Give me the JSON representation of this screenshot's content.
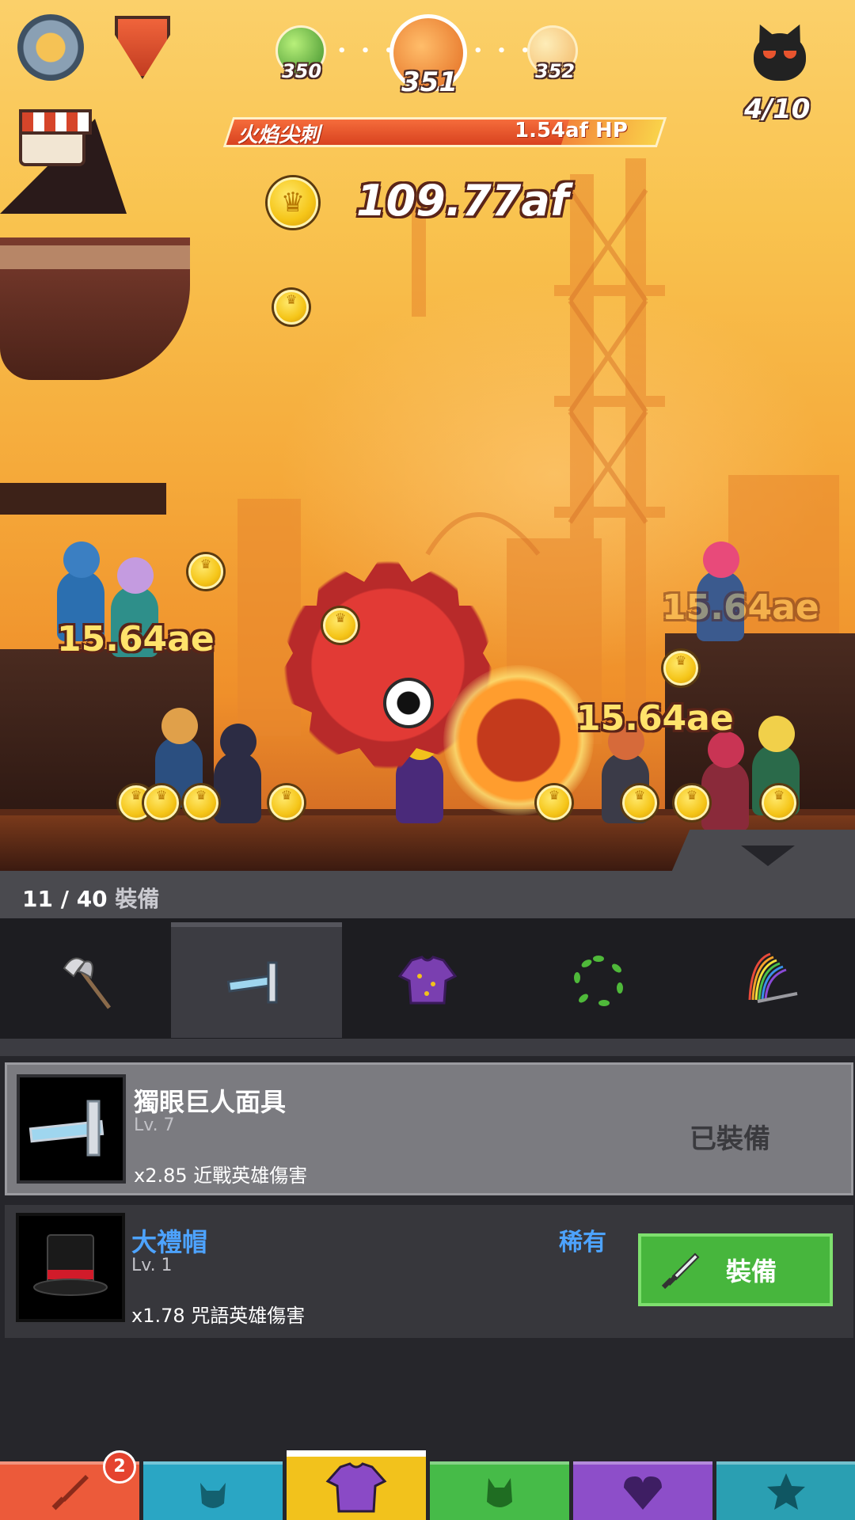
{
  "hud": {
    "settings_icon": "gear-icon",
    "heroes_icon": "shield-swords-icon",
    "shop_icon": "shop-stall-icon",
    "boss_icon": "devil-icon",
    "boss_progress": "4/10",
    "stages": {
      "previous": "350",
      "current": "351",
      "next": "352"
    },
    "boss": {
      "name": "火焰尖刺",
      "hp": "1.54af HP",
      "hp_fraction": 0.78
    },
    "gold": "109.77af"
  },
  "damage_numbers": [
    "15.64ae",
    "15.64ae",
    "15.64ae"
  ],
  "panel": {
    "equip_count": "11 / 40",
    "equip_count_label": "裝備",
    "categories": [
      {
        "name": "axe",
        "icon": "battle-axe-icon"
      },
      {
        "name": "mask",
        "icon": "cyclops-mask-icon",
        "active": true
      },
      {
        "name": "shirt",
        "icon": "purple-shirt-icon"
      },
      {
        "name": "leaves",
        "icon": "leaf-ring-icon"
      },
      {
        "name": "rainbow-sword",
        "icon": "rainbow-sword-icon"
      }
    ],
    "items": [
      {
        "name": "獨眼巨人面具",
        "level": "Lv. 7",
        "effect": "x2.85 近戰英雄傷害",
        "status": "已裝備",
        "icon": "cyclops-mask-icon"
      },
      {
        "name": "大禮帽",
        "level": "Lv. 1",
        "effect": "x1.78 咒語英雄傷害",
        "rarity": "稀有",
        "action": "裝備",
        "icon": "top-hat-icon"
      }
    ]
  },
  "nav": {
    "tabs": [
      {
        "name": "sword",
        "icon": "sword-icon",
        "color": "#ec5a3a",
        "badge": "2"
      },
      {
        "name": "heroes",
        "icon": "helmet-icon",
        "color": "#2aa6c4"
      },
      {
        "name": "equipment",
        "icon": "shirt-icon",
        "color": "#f2c21c",
        "active": true
      },
      {
        "name": "pets",
        "icon": "pet-icon",
        "color": "#46bb48"
      },
      {
        "name": "artifacts",
        "icon": "heart-shield-icon",
        "color": "#8d4ec9"
      },
      {
        "name": "achievements",
        "icon": "star-icon",
        "color": "#2a9fb2"
      }
    ]
  },
  "colors": {
    "sky_top": "#fbd06a",
    "sky_bottom": "#c95f22",
    "equip_button": "#47b63d",
    "rare_text": "#4da3ff"
  }
}
